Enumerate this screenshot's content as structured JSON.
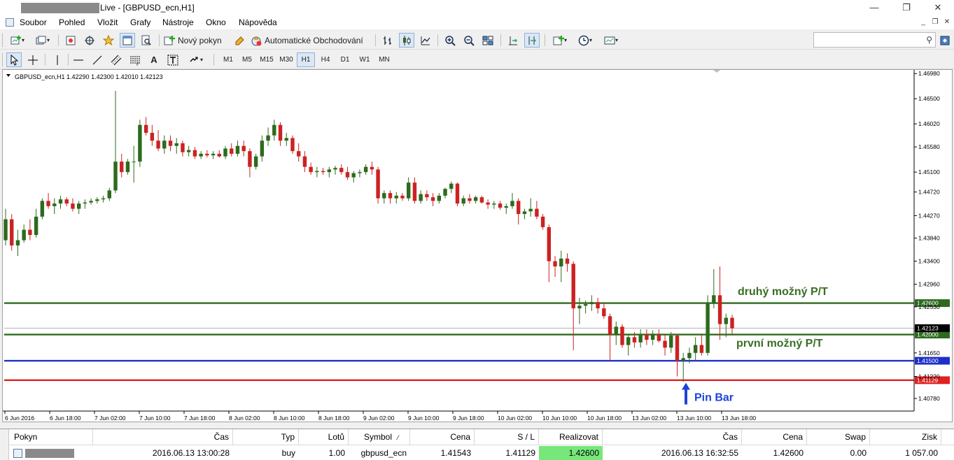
{
  "window": {
    "title": "Live - [GBPUSD_ecn,H1]",
    "title_visible": "Live - [GBPUSD_ecn,H1]",
    "controls": {
      "minimize": "—",
      "maximize": "❐",
      "close": "✕"
    }
  },
  "menu": {
    "items": [
      "Soubor",
      "Pohled",
      "Vložit",
      "Grafy",
      "Nástroje",
      "Okno",
      "Nápověda"
    ],
    "mdi_controls": {
      "minimize": "_",
      "restore": "❐",
      "close": "✕"
    }
  },
  "toolbar": {
    "new_order_label": "Nový pokyn",
    "auto_trading_label": "Automatické Obchodování"
  },
  "timeframes": [
    "M1",
    "M5",
    "M15",
    "M30",
    "H1",
    "H4",
    "D1",
    "W1",
    "MN"
  ],
  "active_timeframe": "H1",
  "search": {
    "placeholder": ""
  },
  "chart_header": "GBPUSD_ecn,H1  1.42290 1.42300 1.42010 1.42123",
  "chart_data": {
    "type": "candlestick",
    "symbol": "GBPUSD_ecn",
    "timeframe": "H1",
    "ylim": [
      1.4054,
      1.4705
    ],
    "y_ticks": [
      1.4698,
      1.465,
      1.4602,
      1.4558,
      1.451,
      1.4472,
      1.4427,
      1.4384,
      1.434,
      1.4296,
      1.4253,
      1.4165,
      1.412,
      1.4078
    ],
    "y_tick_labels": [
      "1.46980",
      "1.46500",
      "1.46020",
      "1.45580",
      "1.45100",
      "1.44720",
      "1.44270",
      "1.43840",
      "1.43400",
      "1.42960",
      "1.42530",
      "1.41650",
      "1.41220",
      "1.40780"
    ],
    "x_tick_labels": [
      "6 Jun 2016",
      "6 Jun 18:00",
      "7 Jun 02:00",
      "7 Jun 10:00",
      "7 Jun 18:00",
      "8 Jun 02:00",
      "8 Jun 10:00",
      "8 Jun 18:00",
      "9 Jun 02:00",
      "9 Jun 10:00",
      "9 Jun 18:00",
      "10 Jun 02:00",
      "10 Jun 10:00",
      "10 Jun 18:00",
      "13 Jun 02:00",
      "13 Jun 10:00",
      "13 Jun 18:00"
    ],
    "bull_color": "#2d6a1e",
    "bear_color": "#cc2222",
    "candles": [
      [
        1.438,
        1.444,
        1.437,
        1.442
      ],
      [
        1.442,
        1.443,
        1.436,
        1.437
      ],
      [
        1.437,
        1.44,
        1.435,
        1.438
      ],
      [
        1.438,
        1.441,
        1.4375,
        1.44
      ],
      [
        1.44,
        1.442,
        1.438,
        1.439
      ],
      [
        1.439,
        1.444,
        1.4385,
        1.4425
      ],
      [
        1.4425,
        1.446,
        1.442,
        1.4455
      ],
      [
        1.4455,
        1.447,
        1.444,
        1.4445
      ],
      [
        1.4445,
        1.446,
        1.443,
        1.445
      ],
      [
        1.445,
        1.4465,
        1.444,
        1.4458
      ],
      [
        1.4458,
        1.4462,
        1.4445,
        1.445
      ],
      [
        1.445,
        1.446,
        1.4435,
        1.444
      ],
      [
        1.444,
        1.4455,
        1.443,
        1.445
      ],
      [
        1.445,
        1.4458,
        1.444,
        1.4452
      ],
      [
        1.4452,
        1.446,
        1.4448,
        1.4455
      ],
      [
        1.4455,
        1.4462,
        1.445,
        1.4458
      ],
      [
        1.4458,
        1.4465,
        1.4452,
        1.446
      ],
      [
        1.446,
        1.448,
        1.4455,
        1.4475
      ],
      [
        1.4475,
        1.4665,
        1.447,
        1.453
      ],
      [
        1.453,
        1.4545,
        1.45,
        1.451
      ],
      [
        1.451,
        1.4535,
        1.4505,
        1.453
      ],
      [
        1.453,
        1.456,
        1.449,
        1.453
      ],
      [
        1.453,
        1.461,
        1.452,
        1.46
      ],
      [
        1.46,
        1.4615,
        1.458,
        1.4585
      ],
      [
        1.4585,
        1.46,
        1.456,
        1.457
      ],
      [
        1.457,
        1.459,
        1.455,
        1.4555
      ],
      [
        1.4555,
        1.458,
        1.4545,
        1.457
      ],
      [
        1.457,
        1.458,
        1.455,
        1.456
      ],
      [
        1.456,
        1.4575,
        1.4545,
        1.4565
      ],
      [
        1.4565,
        1.457,
        1.454,
        1.4548
      ],
      [
        1.4548,
        1.456,
        1.454,
        1.4552
      ],
      [
        1.4552,
        1.4558,
        1.4535,
        1.454
      ],
      [
        1.454,
        1.455,
        1.4535,
        1.4545
      ],
      [
        1.4545,
        1.4552,
        1.4538,
        1.4542
      ],
      [
        1.4542,
        1.455,
        1.4535,
        1.4545
      ],
      [
        1.4545,
        1.4552,
        1.4538,
        1.454
      ],
      [
        1.454,
        1.456,
        1.4535,
        1.4555
      ],
      [
        1.4555,
        1.4565,
        1.454,
        1.4545
      ],
      [
        1.4545,
        1.457,
        1.454,
        1.456
      ],
      [
        1.456,
        1.457,
        1.454,
        1.455
      ],
      [
        1.455,
        1.4555,
        1.45,
        1.452
      ],
      [
        1.452,
        1.4545,
        1.4515,
        1.454
      ],
      [
        1.454,
        1.458,
        1.453,
        1.457
      ],
      [
        1.457,
        1.4595,
        1.456,
        1.458
      ],
      [
        1.458,
        1.461,
        1.457,
        1.46
      ],
      [
        1.46,
        1.4605,
        1.456,
        1.457
      ],
      [
        1.457,
        1.4585,
        1.456,
        1.4575
      ],
      [
        1.4575,
        1.458,
        1.4545,
        1.455
      ],
      [
        1.455,
        1.4565,
        1.453,
        1.454
      ],
      [
        1.454,
        1.455,
        1.451,
        1.452
      ],
      [
        1.452,
        1.4528,
        1.4505,
        1.451
      ],
      [
        1.451,
        1.452,
        1.45,
        1.4512
      ],
      [
        1.4512,
        1.4518,
        1.4505,
        1.451
      ],
      [
        1.451,
        1.452,
        1.45,
        1.4515
      ],
      [
        1.4515,
        1.4522,
        1.4505,
        1.4518
      ],
      [
        1.4518,
        1.4525,
        1.4505,
        1.451
      ],
      [
        1.451,
        1.452,
        1.4495,
        1.45
      ],
      [
        1.45,
        1.4512,
        1.449,
        1.4508
      ],
      [
        1.4508,
        1.4515,
        1.45,
        1.451
      ],
      [
        1.451,
        1.4525,
        1.4505,
        1.452
      ],
      [
        1.452,
        1.453,
        1.4505,
        1.4515
      ],
      [
        1.4515,
        1.452,
        1.445,
        1.446
      ],
      [
        1.446,
        1.4475,
        1.445,
        1.447
      ],
      [
        1.447,
        1.4475,
        1.445,
        1.446
      ],
      [
        1.446,
        1.4472,
        1.445,
        1.4465
      ],
      [
        1.4465,
        1.447,
        1.4455,
        1.446
      ],
      [
        1.446,
        1.45,
        1.4455,
        1.449
      ],
      [
        1.449,
        1.45,
        1.445,
        1.4455
      ],
      [
        1.4455,
        1.4475,
        1.445,
        1.4468
      ],
      [
        1.4468,
        1.4475,
        1.4455,
        1.4462
      ],
      [
        1.4462,
        1.447,
        1.4445,
        1.4455
      ],
      [
        1.4455,
        1.447,
        1.445,
        1.4465
      ],
      [
        1.4465,
        1.448,
        1.446,
        1.4478
      ],
      [
        1.4478,
        1.4492,
        1.447,
        1.4488
      ],
      [
        1.4488,
        1.449,
        1.4445,
        1.445
      ],
      [
        1.445,
        1.4465,
        1.4445,
        1.446
      ],
      [
        1.446,
        1.4468,
        1.445,
        1.4455
      ],
      [
        1.4455,
        1.4465,
        1.445,
        1.4462
      ],
      [
        1.4462,
        1.4465,
        1.445,
        1.4452
      ],
      [
        1.4452,
        1.4458,
        1.444,
        1.4448
      ],
      [
        1.4448,
        1.4455,
        1.444,
        1.445
      ],
      [
        1.445,
        1.4455,
        1.4438,
        1.4442
      ],
      [
        1.4442,
        1.445,
        1.443,
        1.4445
      ],
      [
        1.4445,
        1.447,
        1.444,
        1.4455
      ],
      [
        1.4455,
        1.446,
        1.441,
        1.443
      ],
      [
        1.443,
        1.444,
        1.442,
        1.4435
      ],
      [
        1.4435,
        1.446,
        1.4425,
        1.444
      ],
      [
        1.444,
        1.4455,
        1.442,
        1.4425
      ],
      [
        1.4425,
        1.443,
        1.44,
        1.4405
      ],
      [
        1.4405,
        1.441,
        1.43,
        1.434
      ],
      [
        1.434,
        1.435,
        1.431,
        1.433
      ],
      [
        1.433,
        1.436,
        1.43,
        1.4345
      ],
      [
        1.4345,
        1.4355,
        1.432,
        1.4335
      ],
      [
        1.4335,
        1.434,
        1.417,
        1.425
      ],
      [
        1.425,
        1.427,
        1.422,
        1.4255
      ],
      [
        1.4255,
        1.4265,
        1.424,
        1.4258
      ],
      [
        1.4258,
        1.4275,
        1.4245,
        1.4262
      ],
      [
        1.4262,
        1.427,
        1.424,
        1.425
      ],
      [
        1.425,
        1.426,
        1.423,
        1.4235
      ],
      [
        1.4235,
        1.424,
        1.415,
        1.42
      ],
      [
        1.42,
        1.4225,
        1.418,
        1.4215
      ],
      [
        1.4215,
        1.422,
        1.4175,
        1.418
      ],
      [
        1.418,
        1.42,
        1.416,
        1.4195
      ],
      [
        1.4195,
        1.4205,
        1.4175,
        1.4185
      ],
      [
        1.4185,
        1.421,
        1.4175,
        1.42
      ],
      [
        1.42,
        1.421,
        1.418,
        1.419
      ],
      [
        1.419,
        1.4208,
        1.418,
        1.42
      ],
      [
        1.42,
        1.421,
        1.4185,
        1.4188
      ],
      [
        1.4188,
        1.42,
        1.416,
        1.4175
      ],
      [
        1.4175,
        1.4205,
        1.4165,
        1.4198
      ],
      [
        1.4198,
        1.42,
        1.412,
        1.415
      ],
      [
        1.415,
        1.4165,
        1.411,
        1.4155
      ],
      [
        1.4155,
        1.4175,
        1.4145,
        1.4165
      ],
      [
        1.4165,
        1.4195,
        1.415,
        1.418
      ],
      [
        1.418,
        1.42,
        1.416,
        1.4165
      ],
      [
        1.4165,
        1.4275,
        1.416,
        1.426
      ],
      [
        1.426,
        1.4325,
        1.425,
        1.4275
      ],
      [
        1.4275,
        1.433,
        1.419,
        1.422
      ],
      [
        1.422,
        1.424,
        1.4195,
        1.4232
      ],
      [
        1.4232,
        1.4238,
        1.4201,
        1.4212
      ]
    ],
    "levels": [
      {
        "value": 1.426,
        "label": "1.42600",
        "color": "#2d6a1e"
      },
      {
        "value": 1.42,
        "label": "1.42000",
        "color": "#2d6a1e"
      },
      {
        "value": 1.415,
        "label": "1.41500",
        "color": "#1d2fc8"
      },
      {
        "value": 1.41129,
        "label": "1.41129",
        "color": "#e02020"
      }
    ],
    "current_price": {
      "value": 1.42123,
      "label": "1.42123"
    },
    "annotations": [
      {
        "text": "druhý možný P/T",
        "color": "#3a6e24"
      },
      {
        "text": "první možný P/T",
        "color": "#3a6e24"
      },
      {
        "text": "Pin Bar",
        "color": "#1d44d8"
      }
    ]
  },
  "terminal": {
    "headers": [
      "Pokyn",
      "Čas",
      "Typ",
      "Lotů",
      "Symbol",
      "Cena",
      "S / L",
      "Realizovat zisk",
      "Čas",
      "Cena",
      "Swap",
      "Zisk"
    ],
    "row": {
      "time": "2016.06.13 13:00:28",
      "type": "buy",
      "lots": "1.00",
      "symbol": "gbpusd_ecn",
      "price": "1.41543",
      "sl": "1.41129",
      "tp": "1.42600",
      "cur_time": "2016.06.13 16:32:55",
      "cur_price": "1.42600",
      "swap": "0.00",
      "profit": "1 057.00"
    }
  },
  "colors": {
    "tp_highlight": "#77e77a",
    "chart_bg": "#ffffff"
  }
}
